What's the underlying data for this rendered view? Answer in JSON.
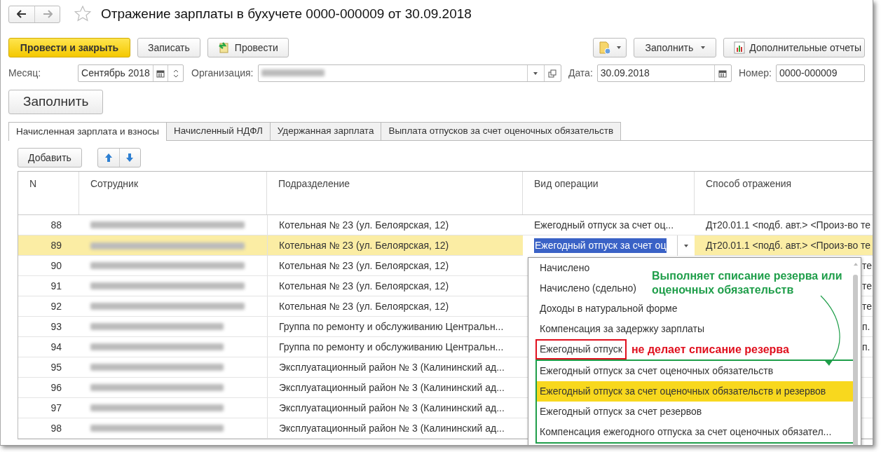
{
  "window": {
    "title": "Отражение зарплаты в бухучете 0000-000009 от 30.09.2018"
  },
  "nav": [
    {
      "kind": "back",
      "disabled": false
    },
    {
      "kind": "forward",
      "disabled": true
    }
  ],
  "toolbar": {
    "left": [
      {
        "kind": "primary",
        "label": "Провести и закрыть"
      },
      {
        "kind": "plain",
        "label": "Записать"
      },
      {
        "kind": "post",
        "label": "Провести"
      }
    ],
    "right": [
      {
        "kind": "doc-menu"
      },
      {
        "kind": "menu",
        "label": "Заполнить"
      },
      {
        "kind": "report",
        "label": "Дополнительные отчеты"
      }
    ]
  },
  "fields": [
    {
      "kind": "month",
      "label": "Месяц:",
      "value": "Сентябрь 2018"
    },
    {
      "kind": "org",
      "label": "Организация:"
    },
    {
      "kind": "date",
      "label": "Дата:",
      "value": "30.09.2018"
    },
    {
      "kind": "plain",
      "label": "Номер:",
      "value": "0000-000009"
    }
  ],
  "fill_button": "Заполнить",
  "tabs": [
    {
      "label": "Начисленная зарплата и взносы",
      "selected": true
    },
    {
      "label": "Начисленный НДФЛ",
      "selected": false
    },
    {
      "label": "Удержанная зарплата",
      "selected": false
    },
    {
      "label": "Выплата отпусков за счет оценочных обязательств",
      "selected": false
    }
  ],
  "table_toolbar": {
    "add": "Добавить"
  },
  "table": {
    "columns": [
      "N",
      "Сотрудник",
      "Подразделение",
      "Вид операции",
      "Способ отражения"
    ],
    "rows": [
      {
        "n": "88",
        "department": "Котельная № 23 (ул. Белоярская, 12)",
        "operation": "Ежегодный отпуск за счет оц...",
        "posting": "Дт20.01.1 <подб. авт.> <Произ-во те",
        "selected": false
      },
      {
        "n": "89",
        "department": "Котельная № 23 (ул. Белоярская, 12)",
        "operation": "Ежегодный отпуск за счет оц",
        "posting": "Дт20.01.1 <подб. авт.> <Произ-во те",
        "selected": true
      },
      {
        "n": "90",
        "department": "Котельная № 23 (ул. Белоярская, 12)",
        "posting": "те",
        "selected": false
      },
      {
        "n": "91",
        "department": "Котельная № 23 (ул. Белоярская, 12)",
        "posting": "те",
        "selected": false
      },
      {
        "n": "92",
        "department": "Котельная № 23 (ул. Белоярская, 12)",
        "posting": "те",
        "selected": false
      },
      {
        "n": "93",
        "department": "Группа по ремонту и обслуживанию Центральн...",
        "posting": "п.",
        "selected": false
      },
      {
        "n": "94",
        "department": "Группа по ремонту и обслуживанию Центральн...",
        "posting": "п.",
        "selected": false
      },
      {
        "n": "95",
        "department": "Эксплуатационный район № 3 (Калининский ад...",
        "selected": false
      },
      {
        "n": "96",
        "department": "Эксплуатационный район № 3 (Калининский ад...",
        "selected": false
      },
      {
        "n": "97",
        "department": "Эксплуатационный район № 3 (Калининский ад...",
        "selected": false
      },
      {
        "n": "98",
        "department": "Эксплуатационный район № 3 (Калининский ад...",
        "selected": false
      }
    ]
  },
  "dropdown": {
    "callout": {
      "text": "Выполняет списание резерва или оценочных обязательств",
      "color": "#1f9e4a"
    },
    "entries": [
      {
        "kind": "item",
        "label": "Начислено",
        "selected": false
      },
      {
        "kind": "item",
        "label": "Начислено (сдельно)",
        "selected": false
      },
      {
        "kind": "item",
        "label": "Доходы в натуральной форме",
        "selected": false
      },
      {
        "kind": "item",
        "label": "Компенсация за задержку зарплаты",
        "selected": false
      },
      {
        "kind": "box",
        "color": "#e0101e",
        "note": "не делает списание резерва",
        "items": [
          {
            "label": "Ежегодный отпуск",
            "selected": false
          }
        ]
      },
      {
        "kind": "box",
        "color": "#1f9e4a",
        "items": [
          {
            "label": "Ежегодный отпуск за счет оценочных обязательств",
            "selected": false
          },
          {
            "label": "Ежегодный отпуск за счет оценочных обязательств и резервов",
            "selected": true
          },
          {
            "label": "Ежегодный отпуск за счет резервов",
            "selected": false
          },
          {
            "label": "Компенсация ежегодного отпуска за счет оценочных обязател...",
            "selected": false
          }
        ]
      }
    ]
  }
}
